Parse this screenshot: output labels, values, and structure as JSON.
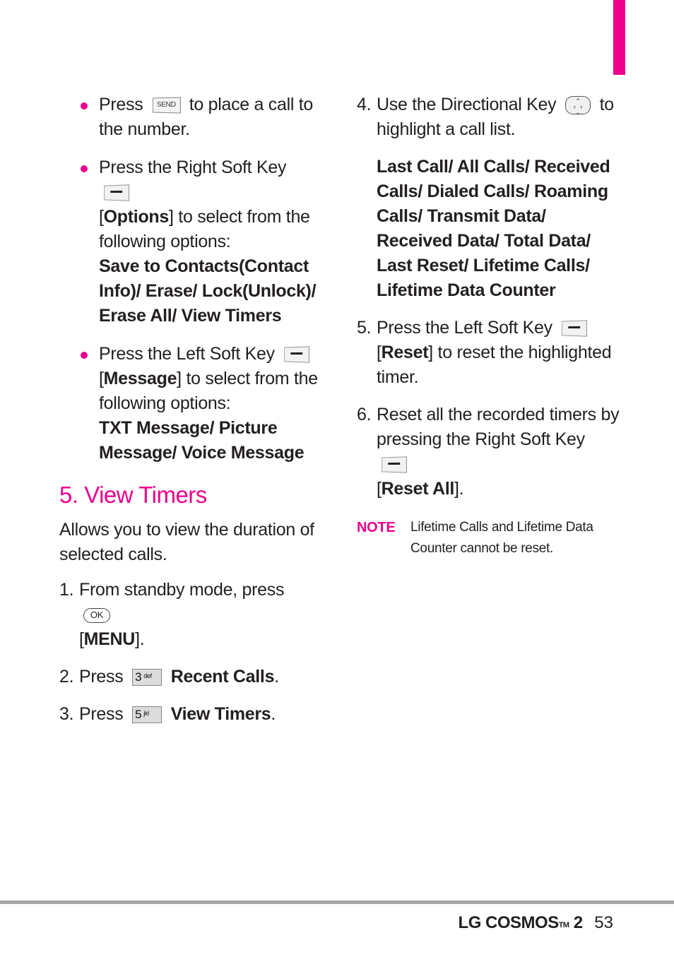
{
  "page": {
    "accent_color": "#ec008c",
    "bullets": [
      {
        "pre": "Press",
        "key": "SEND",
        "post": "to place a call to the number."
      },
      {
        "pre": "Press the Right Soft Key",
        "bracket": "Options",
        "post": "to select from the following options:",
        "options": "Save to Contacts(Contact Info)/ Erase/ Lock(Unlock)/ Erase All/ View Timers"
      },
      {
        "pre": "Press the Left Soft Key",
        "bracket": "Message",
        "post": "to select from the following options:",
        "options": "TXT Message/ Picture Message/ Voice Message"
      }
    ],
    "section": {
      "title": "5. View Timers",
      "intro": "Allows you to view the duration of selected calls.",
      "steps": [
        {
          "num": "1.",
          "pre": "From standby mode, press",
          "key": "OK",
          "bracket": "MENU",
          "post": "."
        },
        {
          "num": "2.",
          "pre": "Press",
          "key_num": "3",
          "key_letters": "def",
          "bold": "Recent Calls",
          "post": "."
        },
        {
          "num": "3.",
          "pre": "Press",
          "key_num": "5",
          "key_letters": "jkl",
          "bold": "View Timers",
          "post": "."
        },
        {
          "num": "4.",
          "pre": "Use the Directional Key",
          "post": "to highlight a call list.",
          "options": "Last Call/ All Calls/ Received Calls/ Dialed Calls/ Roaming Calls/ Transmit Data/ Received Data/ Total Data/ Last Reset/ Lifetime Calls/ Lifetime Data Counter"
        },
        {
          "num": "5.",
          "pre": "Press the Left Soft Key",
          "bracket": "Reset",
          "post": "to reset the highlighted timer."
        },
        {
          "num": "6.",
          "pre": "Reset all the recorded timers by pressing the Right Soft Key",
          "bracket": "Reset All",
          "post": "."
        }
      ]
    },
    "note": {
      "label": "NOTE",
      "text": "Lifetime Calls and Lifetime Data Counter cannot be reset."
    },
    "footer": {
      "brand": "LG COSMOS",
      "trademark": "TM",
      "model": "2",
      "page_number": "53"
    },
    "icons": {
      "send": "send-key-icon",
      "soft": "soft-key-icon",
      "ok": "ok-key-icon",
      "dir": "directional-key-icon",
      "num3": "key-3-icon",
      "num5": "key-5-icon"
    }
  }
}
